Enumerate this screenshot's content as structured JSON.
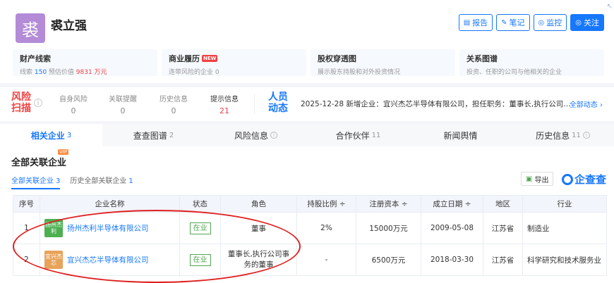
{
  "header": {
    "avatar_char": "裘",
    "name": "裘立强",
    "buttons": [
      "报告",
      "笔记",
      "监控",
      "关注"
    ],
    "corner_mark": "↖"
  },
  "cards": [
    {
      "title": "财产线索",
      "parts": [
        "线索 ",
        "150",
        " 预估价值 ",
        "9831 万元"
      ]
    },
    {
      "title": "商业履历",
      "badge": "NEW",
      "sub": "连带风险的企业 0"
    },
    {
      "title": "股权穿透图",
      "sub": "展示股东持股和对外投资情况"
    },
    {
      "title": "关系图谱",
      "sub": "投资、任职的公司与他相关的企业"
    }
  ],
  "risk": {
    "title": "风险扫描",
    "items": [
      {
        "label": "自身风险",
        "value": "0"
      },
      {
        "label": "关联提醒",
        "value": "0"
      },
      {
        "label": "历史信息",
        "value": "0"
      },
      {
        "label": "提示信息",
        "value": "21"
      }
    ]
  },
  "person_news": {
    "title": "人员动态",
    "text": "2025-12-28 新增企业：宜兴杰芯半导体有限公司，担任职务：董事长,执行公司…",
    "all_label": "全部动态 ›"
  },
  "tabs": [
    {
      "label": "相关企业",
      "count": "3"
    },
    {
      "label": "查查图谱",
      "count": "2"
    },
    {
      "label": "风险信息",
      "count": ""
    },
    {
      "label": "合作伙伴",
      "count": "11"
    },
    {
      "label": "新闻舆情",
      "count": ""
    },
    {
      "label": "历史信息",
      "count": "11"
    }
  ],
  "section": {
    "title": "全部关联企业",
    "vip": "VIP",
    "subtabs": [
      {
        "label": "全部关联企业",
        "count": "3"
      },
      {
        "label": "历史全部关联企业",
        "count": "1"
      }
    ],
    "export_label": "导出",
    "brand": "企查查"
  },
  "table": {
    "headers": [
      "序号",
      "企业名称",
      "状态",
      "角色",
      "持股比例 ÷",
      "注册资本 ÷",
      "成立日期 ÷",
      "地区",
      "行业"
    ],
    "rows": [
      {
        "index": "1",
        "logo": "扬州杰利",
        "logo_color": "#4caf50",
        "name": "扬州杰利半导体有限公司",
        "status": "在业",
        "role": "董事",
        "share": "2%",
        "capital": "15000万元",
        "date": "2009-05-08",
        "region": "江苏省",
        "industry": "制造业"
      },
      {
        "index": "2",
        "logo": "宜兴杰芯",
        "logo_color": "#e8a35a",
        "name": "宜兴杰芯半导体有限公司",
        "status": "在业",
        "role": "董事长,执行公司事务的董事",
        "share": "-",
        "capital": "6500万元",
        "date": "2018-03-30",
        "region": "江苏省",
        "industry": "科学研究和技术服务业"
      }
    ]
  },
  "colors": {
    "accent": "#1677ff",
    "risk": "#f04142",
    "ok": "#52a752",
    "annotation": "#e02020"
  }
}
